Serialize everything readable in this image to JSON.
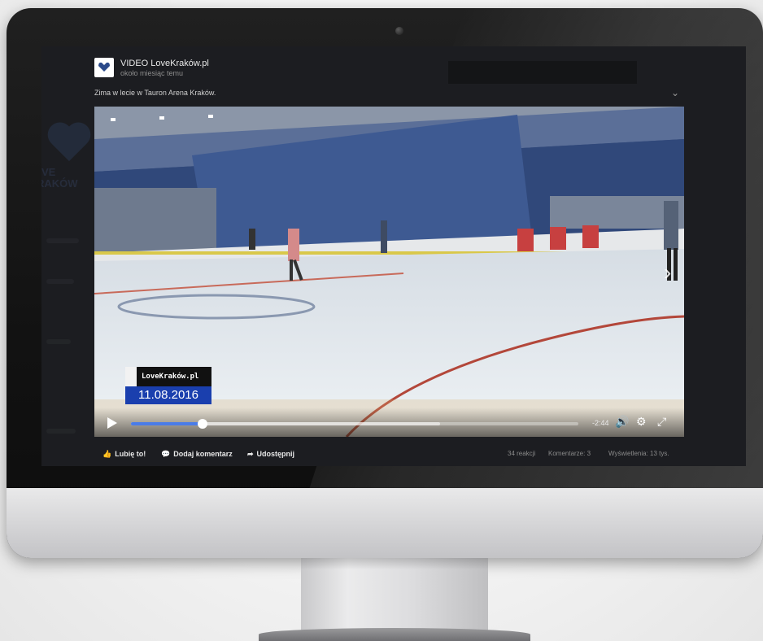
{
  "post": {
    "page_name": "VIDEO LoveKraków.pl",
    "time": "około miesiąc temu",
    "text": "Zima w lecie w Tauron Arena Kraków."
  },
  "video": {
    "watermark_brand": "LoveKraków.pl",
    "watermark_date": "11.08.2016",
    "time_remaining": "-2:44",
    "progress_fraction": 0.16,
    "buffered_fraction": 0.69
  },
  "actions": {
    "like": "Lubię to!",
    "comment": "Dodaj komentarz",
    "share": "Udostępnij"
  },
  "stats": {
    "reactions": "34 reakcji",
    "comments": "Komentarze: 3",
    "views": "Wyświetlenia: 13 tys."
  },
  "background_page": {
    "logo_text_1": "VE",
    "logo_text_2": "RAKÓW"
  },
  "colors": {
    "accent": "#4a7ce8",
    "watermark_blue": "#1a3fae"
  },
  "icons": {
    "like": "thumbs-up-icon",
    "comment": "comment-icon",
    "share": "share-arrow-icon",
    "volume": "volume-icon",
    "settings": "gear-icon",
    "fullscreen": "fullscreen-icon",
    "play": "play-icon",
    "next": "chevron-right-icon",
    "menu": "chevron-down-icon"
  }
}
